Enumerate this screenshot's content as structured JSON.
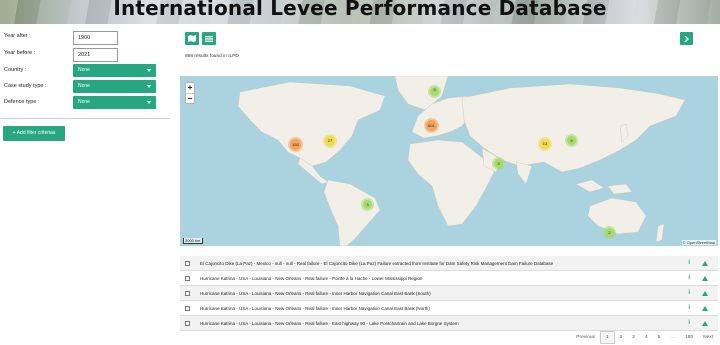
{
  "header": {
    "title": "International Levee Performance Database"
  },
  "sidebar": {
    "year_after_label": "Year after :",
    "year_after_value": "1900",
    "year_before_label": "Year before :",
    "year_before_value": "2021",
    "country_label": "Country :",
    "country_value": "None",
    "case_study_label": "Case study type :",
    "case_study_value": "None",
    "defence_label": "Defence type :",
    "defence_value": "None",
    "add_filter_label": "+ Add filter criterias"
  },
  "toolbar": {
    "map_icon": "map-icon",
    "list_icon": "list-icon",
    "next_icon": "chevron-right-icon"
  },
  "results": {
    "count_text": "898 results found in ILPD"
  },
  "map": {
    "zoom_in": "+",
    "zoom_out": "−",
    "scale_label": "3000 km",
    "attribution": "© OpenStreetMap",
    "clusters": [
      {
        "value": "3",
        "color": "#a6d96a"
      },
      {
        "value": "601",
        "color": "#f5a35c"
      },
      {
        "value": "160",
        "color": "#f5a35c"
      },
      {
        "value": "27",
        "color": "#f1d94c"
      },
      {
        "value": "3",
        "color": "#a6d96a"
      },
      {
        "value": "13",
        "color": "#f1d94c"
      },
      {
        "value": "9",
        "color": "#a6d96a"
      },
      {
        "value": "3",
        "color": "#a6d96a"
      },
      {
        "value": "2",
        "color": "#a6d96a"
      }
    ]
  },
  "list": {
    "rows": [
      {
        "text": "El Cajoncito Dike (La Paz) - Mexico - null - null - Real failure - El Cajoncito Dike (La Paz) Failure extracted from Institute for Dam Safety Risk Management Dam Failure Database"
      },
      {
        "text": "Hurricane Katrina - USA - Louisiana - New Orleans - Real failure - Pointe à la Hache - Lower Mississippi Region"
      },
      {
        "text": "Hurricane Katrina - USA - Louisiana - New Orleans - Real failure - Inner Harbor Navigation Canal East Bank (South)"
      },
      {
        "text": "Hurricane Katrina - USA - Louisiana - New Orleans - Real failure - Inner Harbor Navigation Canal East Bank (North)"
      },
      {
        "text": "Hurricane Katrina - USA - Louisiana - New Orleans - Real failure - East highway 90 - Lake Pontchartrain and Lake Borgne System"
      }
    ]
  },
  "pagination": {
    "previous": "Previous",
    "pages": [
      "1",
      "2",
      "3",
      "4",
      "5",
      "…",
      "180"
    ],
    "next": "Next"
  },
  "colors": {
    "accent": "#26a781",
    "ocean": "#aad3df",
    "land": "#f2efe9"
  }
}
